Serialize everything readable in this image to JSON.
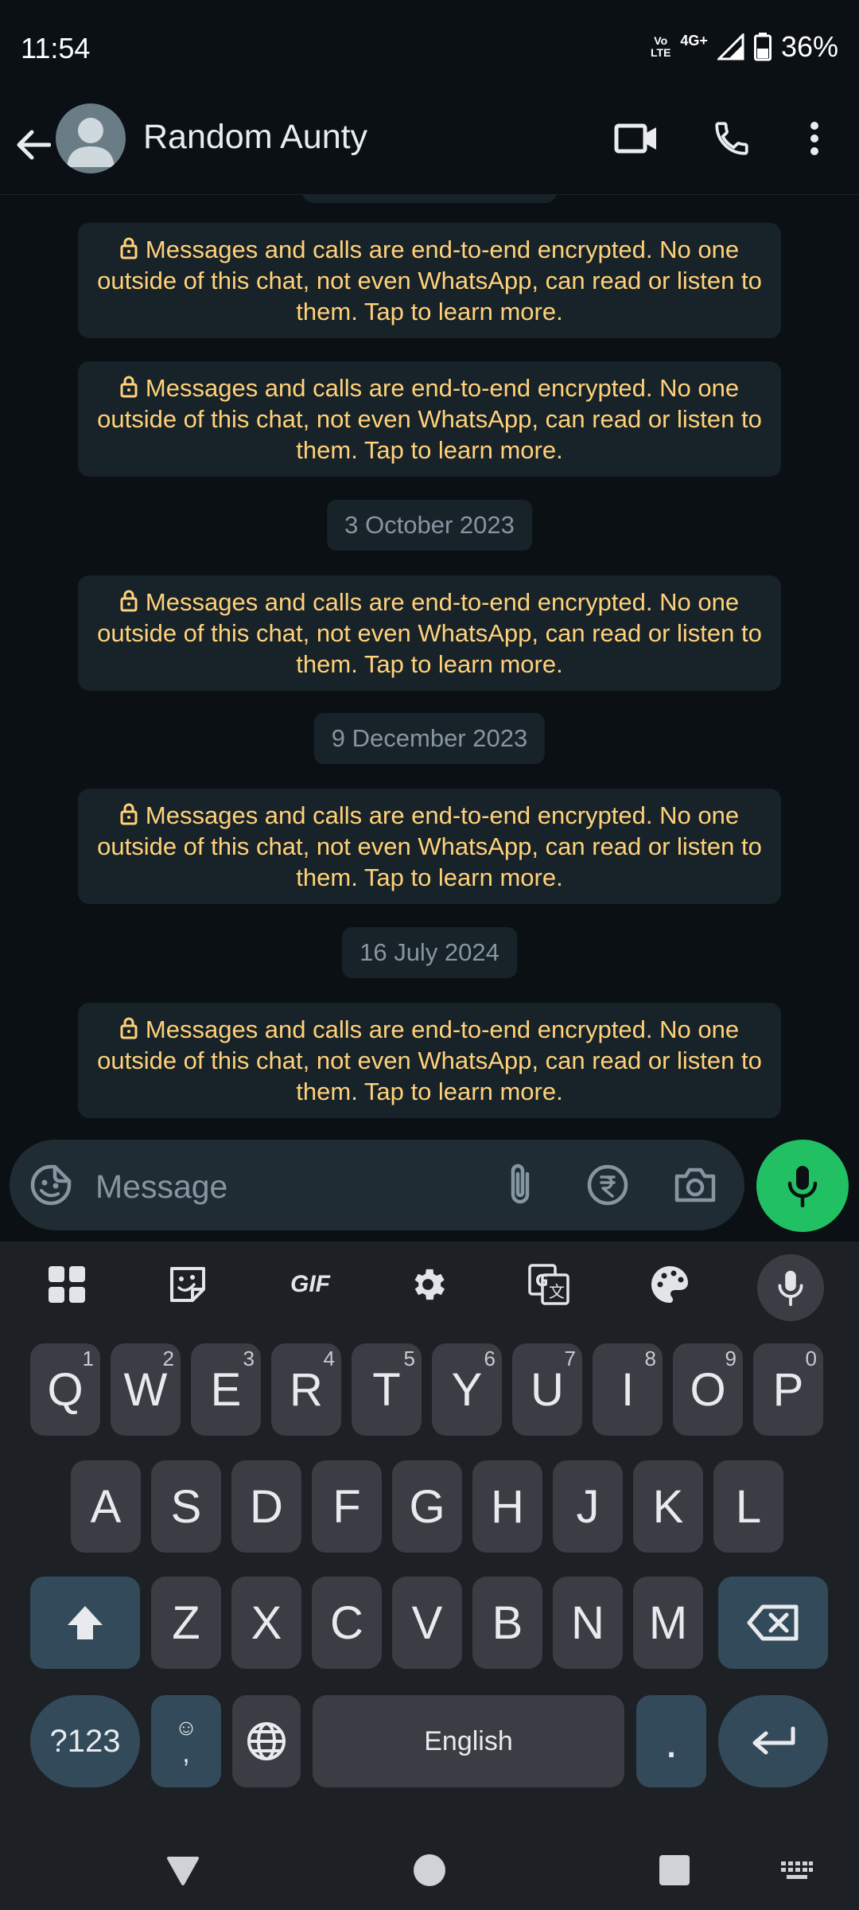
{
  "status_bar": {
    "time": "11:54",
    "volte_top": "Vo",
    "volte_bottom": "LTE",
    "network": "4G+",
    "battery": "36%"
  },
  "header": {
    "contact_name": "Random Aunty",
    "icons": [
      "back-arrow-icon",
      "avatar",
      "video-call-icon",
      "voice-call-icon",
      "more-options-icon"
    ]
  },
  "chat": {
    "encryption_text": "Messages and calls are end-to-end encrypted. No one outside of this chat, not even WhatsApp, can read or listen to them. Tap to learn more.",
    "date_1": "3 October 2023",
    "date_2": "9 December 2023",
    "date_3": "16 July 2024"
  },
  "composer": {
    "placeholder": "Message",
    "icons": [
      "sticker-icon",
      "attach-icon",
      "payment-rupee-icon",
      "camera-icon",
      "mic-icon"
    ]
  },
  "keyboard": {
    "toolbar": [
      "apps-grid-icon",
      "sticker-icon",
      "GIF",
      "settings-icon",
      "translate-icon",
      "palette-icon",
      "mic-icon"
    ],
    "gif_label": "GIF",
    "row1": [
      {
        "k": "Q",
        "h": "1"
      },
      {
        "k": "W",
        "h": "2"
      },
      {
        "k": "E",
        "h": "3"
      },
      {
        "k": "R",
        "h": "4"
      },
      {
        "k": "T",
        "h": "5"
      },
      {
        "k": "Y",
        "h": "6"
      },
      {
        "k": "U",
        "h": "7"
      },
      {
        "k": "I",
        "h": "8"
      },
      {
        "k": "O",
        "h": "9"
      },
      {
        "k": "P",
        "h": "0"
      }
    ],
    "row2": [
      "A",
      "S",
      "D",
      "F",
      "G",
      "H",
      "J",
      "K",
      "L"
    ],
    "row3": [
      "Z",
      "X",
      "C",
      "V",
      "B",
      "N",
      "M"
    ],
    "symbols_label": "?123",
    "comma_label": ",",
    "space_label": "English",
    "period_label": "."
  },
  "colors": {
    "accent_green": "#21c063",
    "encryption_text": "#ffd279",
    "bubble_bg": "#182229",
    "chat_bg": "#0b1014"
  }
}
